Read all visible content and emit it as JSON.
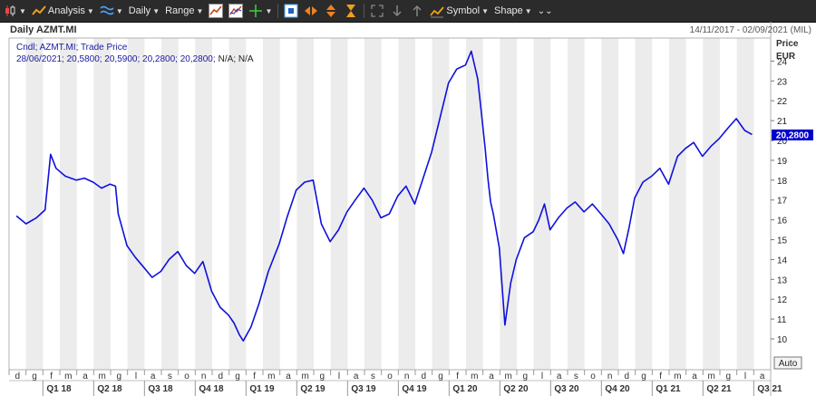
{
  "toolbar": {
    "analysis_label": "Analysis",
    "interval_label": "Daily",
    "range_label": "Range",
    "symbol_label": "Symbol",
    "shape_label": "Shape"
  },
  "header": {
    "title": "Daily AZMT.MI",
    "date_range": "14/11/2017 - 02/09/2021 (MIL)",
    "series_desc": "Cndl; AZMT.MI; Trade Price",
    "ohlc_line": "28/06/2021; 20,5800; 20,5900; 20,2800; 20,2800;",
    "na_text": "N/A; N/A"
  },
  "axis": {
    "price_label": "Price",
    "currency_label": "EUR",
    "auto_label": "Auto",
    "last_price_label": "20,2800"
  },
  "colors": {
    "series": "#1010dd",
    "band": "#ececec",
    "toolbar_bg": "#2b2b2b",
    "header_blue": "#1a1aa0"
  },
  "chart_data": {
    "type": "line",
    "title": "Daily AZMT.MI",
    "ylabel": "Price",
    "ylim": [
      9,
      26
    ],
    "yticks": [
      10,
      11,
      12,
      13,
      14,
      15,
      16,
      17,
      18,
      19,
      20,
      21,
      22,
      23,
      24
    ],
    "month_labels": [
      "d",
      "g",
      "f",
      "m",
      "a",
      "m",
      "g",
      "l",
      "a",
      "s",
      "o",
      "n",
      "d",
      "g",
      "f",
      "m",
      "a",
      "m",
      "g",
      "l",
      "a",
      "s",
      "o",
      "n",
      "d",
      "g",
      "f",
      "m",
      "a",
      "m",
      "g",
      "l",
      "a",
      "s",
      "o",
      "n",
      "d",
      "g",
      "f",
      "m",
      "a",
      "m",
      "g",
      "l",
      "a"
    ],
    "quarter_labels": [
      "Q1 18",
      "Q2 18",
      "Q3 18",
      "Q4 18",
      "Q1 19",
      "Q2 19",
      "Q3 19",
      "Q4 19",
      "Q1 20",
      "Q2 20",
      "Q3 20",
      "Q4 20",
      "Q1 21",
      "Q2 21",
      "Q3 21"
    ],
    "series": [
      {
        "last": 20.28,
        "x": [
          "2017-11-14",
          "2017-12-01",
          "2017-12-20",
          "2018-01-05",
          "2018-01-15",
          "2018-01-25",
          "2018-02-10",
          "2018-02-28",
          "2018-03-15",
          "2018-03-31",
          "2018-04-15",
          "2018-04-30",
          "2018-05-10",
          "2018-05-15",
          "2018-05-31",
          "2018-06-15",
          "2018-06-30",
          "2018-07-15",
          "2018-07-31",
          "2018-08-15",
          "2018-08-31",
          "2018-09-15",
          "2018-09-30",
          "2018-10-15",
          "2018-10-31",
          "2018-11-15",
          "2018-11-30",
          "2018-12-10",
          "2018-12-20",
          "2018-12-27",
          "2019-01-10",
          "2019-01-25",
          "2019-02-10",
          "2019-02-28",
          "2019-03-15",
          "2019-03-31",
          "2019-04-15",
          "2019-04-30",
          "2019-05-15",
          "2019-05-31",
          "2019-06-15",
          "2019-06-30",
          "2019-07-15",
          "2019-07-31",
          "2019-08-15",
          "2019-08-31",
          "2019-09-15",
          "2019-09-30",
          "2019-10-15",
          "2019-10-31",
          "2019-11-15",
          "2019-11-30",
          "2019-12-15",
          "2019-12-31",
          "2020-01-15",
          "2020-01-31",
          "2020-02-10",
          "2020-02-21",
          "2020-02-28",
          "2020-03-05",
          "2020-03-10",
          "2020-03-15",
          "2020-03-20",
          "2020-03-31",
          "2020-04-10",
          "2020-04-20",
          "2020-04-30",
          "2020-05-15",
          "2020-05-31",
          "2020-06-10",
          "2020-06-20",
          "2020-06-30",
          "2020-07-15",
          "2020-07-31",
          "2020-08-15",
          "2020-08-31",
          "2020-09-15",
          "2020-09-30",
          "2020-10-15",
          "2020-10-31",
          "2020-11-10",
          "2020-11-20",
          "2020-11-30",
          "2020-12-15",
          "2020-12-31",
          "2021-01-15",
          "2021-01-31",
          "2021-02-15",
          "2021-02-28",
          "2021-03-15",
          "2021-03-31",
          "2021-04-15",
          "2021-04-30",
          "2021-05-15",
          "2021-05-31",
          "2021-06-15",
          "2021-06-28"
        ],
        "y": [
          16.2,
          15.8,
          16.1,
          16.5,
          19.3,
          18.6,
          18.2,
          18.0,
          18.1,
          17.9,
          17.6,
          17.8,
          17.7,
          16.3,
          14.7,
          14.1,
          13.6,
          13.1,
          13.4,
          14.0,
          14.4,
          13.7,
          13.3,
          13.9,
          12.4,
          11.6,
          11.2,
          10.8,
          10.2,
          9.9,
          10.6,
          11.8,
          13.4,
          14.8,
          16.2,
          17.5,
          17.9,
          18.0,
          15.8,
          14.9,
          15.5,
          16.4,
          17.0,
          17.6,
          17.0,
          16.1,
          16.3,
          17.2,
          17.7,
          16.8,
          18.1,
          19.4,
          21.1,
          22.9,
          23.6,
          23.8,
          24.5,
          23.1,
          21.2,
          19.6,
          18.1,
          16.9,
          16.3,
          14.6,
          10.7,
          12.8,
          14.0,
          15.1,
          15.4,
          16.0,
          16.8,
          15.5,
          16.1,
          16.6,
          16.9,
          16.4,
          16.8,
          16.3,
          15.8,
          15.0,
          14.3,
          15.6,
          17.1,
          17.9,
          18.2,
          18.6,
          17.8,
          19.2,
          19.6,
          19.9,
          19.2,
          19.7,
          20.1,
          20.6,
          21.1,
          20.5,
          20.3
        ]
      }
    ]
  }
}
